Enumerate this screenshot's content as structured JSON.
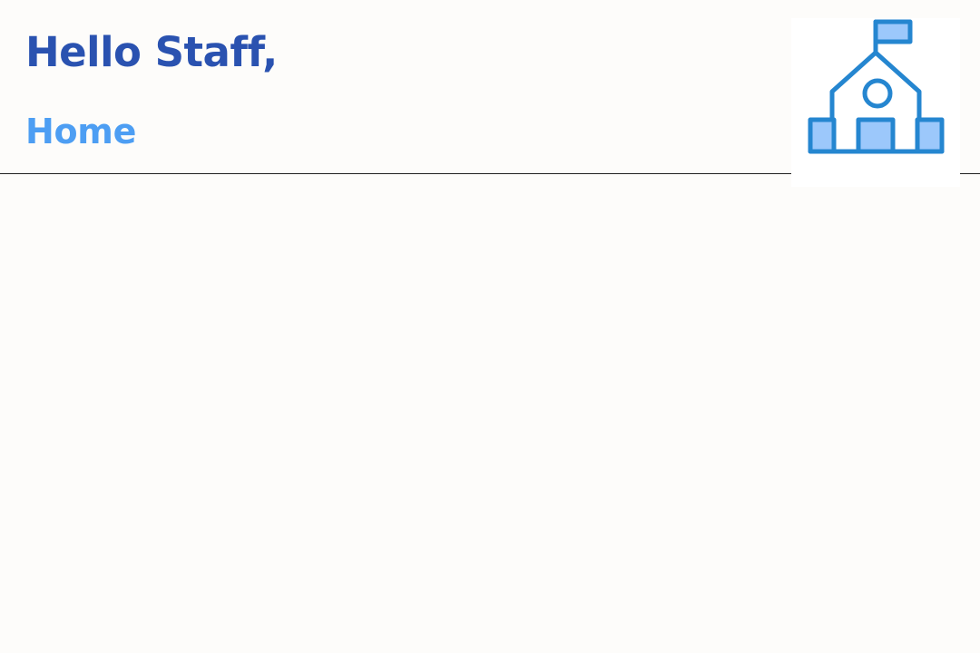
{
  "header": {
    "greeting": "Hello Staff,",
    "section_title": "Home"
  },
  "logo": {
    "icon": "school-icon"
  },
  "colors": {
    "greeting": "#2a52b0",
    "section_title": "#4d9ef3",
    "icon_stroke": "#2586d0",
    "icon_fill": "#9cc8fb",
    "background": "#fdfcfa",
    "divider": "#1f1f1f"
  }
}
